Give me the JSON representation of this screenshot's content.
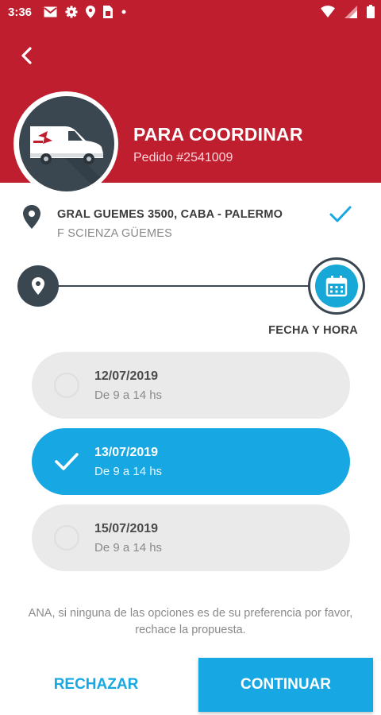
{
  "status_bar": {
    "time": "3:36",
    "left_icons": [
      "mail-icon",
      "gear-icon",
      "location-icon",
      "sim-card-icon",
      "dot-icon"
    ],
    "right_icons": [
      "wifi-icon",
      "signal-icon",
      "battery-icon"
    ]
  },
  "colors": {
    "header_red": "#bf1e2e",
    "accent_blue": "#17a8e3",
    "dark_slate": "#3a4650"
  },
  "header": {
    "title": "PARA COORDINAR",
    "order_number": "Pedido #2541009",
    "avatar_icon": "delivery-van-icon"
  },
  "address": {
    "line1": "GRAL GUEMES 3500, CABA - PALERMO",
    "line2": "F SCIENZA GÜEMES"
  },
  "progress": {
    "start_icon": "location-pin-icon",
    "end_icon": "calendar-icon",
    "label": "FECHA Y HORA"
  },
  "options": [
    {
      "date": "12/07/2019",
      "time": "De 9 a 14 hs",
      "selected": false
    },
    {
      "date": "13/07/2019",
      "time": "De 9 a 14 hs",
      "selected": true
    },
    {
      "date": "15/07/2019",
      "time": "De 9 a 14 hs",
      "selected": false
    }
  ],
  "note": "ANA, si ninguna de las opciones es de su preferencia por favor, rechace la propuesta.",
  "actions": {
    "reject_label": "RECHAZAR",
    "continue_label": "CONTINUAR"
  }
}
